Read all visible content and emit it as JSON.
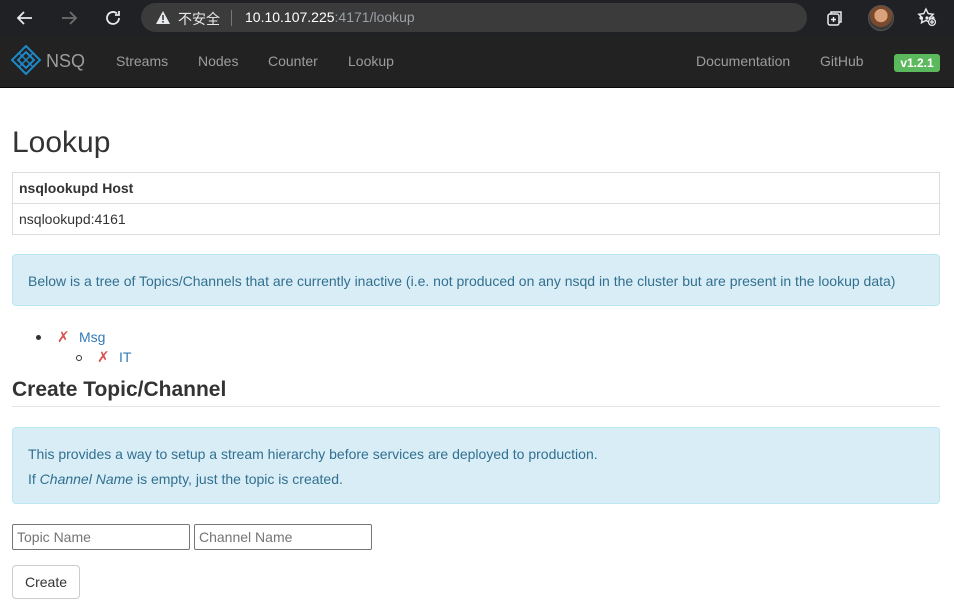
{
  "browser": {
    "security_label": "不安全",
    "url_host": "10.10.107.225",
    "url_rest": ":4171/lookup",
    "icons": [
      "back-arrow-icon",
      "forward-arrow-icon",
      "reload-icon",
      "warning-icon",
      "favorites-add-icon",
      "collections-icon",
      "avatar",
      "more-menu-icon"
    ]
  },
  "navbar": {
    "brand": "NSQ",
    "links": [
      "Streams",
      "Nodes",
      "Counter",
      "Lookup"
    ],
    "right_links": [
      "Documentation",
      "GitHub"
    ],
    "version": "v1.2.1",
    "version_color": "#5cb85c"
  },
  "main": {
    "title": "Lookup",
    "table": {
      "header": "nsqlookupd Host",
      "rows": [
        "nsqlookupd:4161"
      ]
    },
    "inactive_alert": "Below is a tree of Topics/Channels that are currently inactive (i.e. not produced on any nsqd in the cluster but are present in the lookup data)",
    "tree": {
      "topic": "Msg",
      "channel": "IT",
      "mark": "✗"
    },
    "create_section": {
      "title": "Create Topic/Channel",
      "info_line1": "This provides a way to setup a stream hierarchy before services are deployed to production.",
      "info_line2_prefix": "If ",
      "info_line2_em": "Channel Name",
      "info_line2_suffix": " is empty, just the topic is created.",
      "topic_placeholder": "Topic Name",
      "channel_placeholder": "Channel Name",
      "create_label": "Create"
    }
  }
}
